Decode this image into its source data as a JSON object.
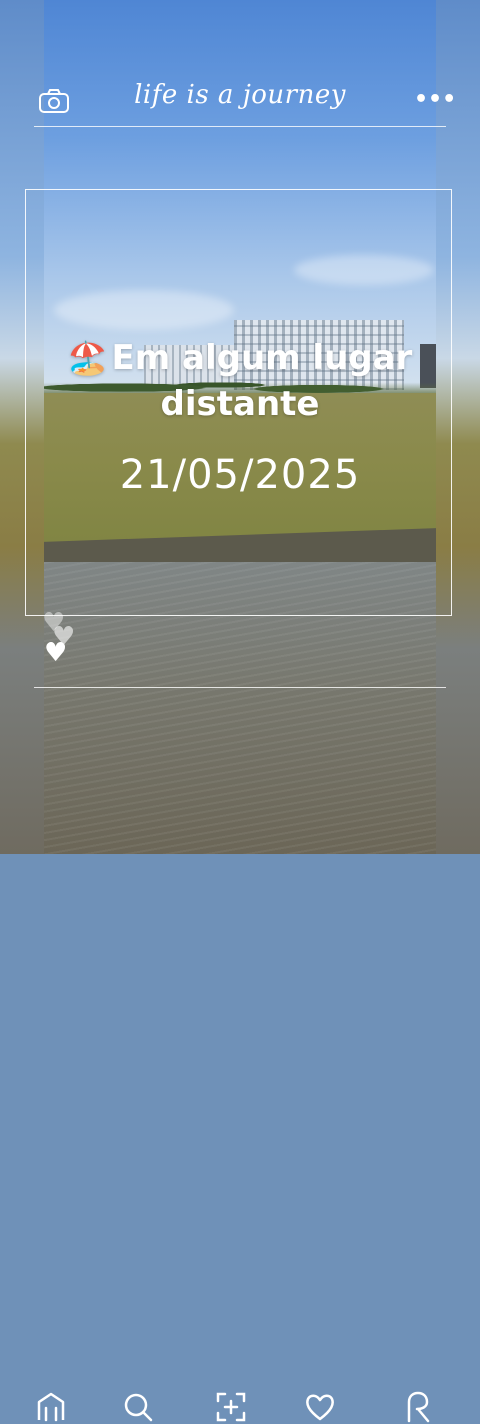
{
  "header": {
    "brand": "life is a journey",
    "camera_icon": "camera-icon",
    "more_icon": "more-dots-icon"
  },
  "overlay": {
    "emoji": "🏖️",
    "title": "Em algum lugar distante",
    "date": "21/05/2025"
  },
  "nav": {
    "items": [
      "home-icon",
      "search-icon",
      "add-photo-icon",
      "heart-icon",
      "profile-icon"
    ]
  },
  "colors": {
    "overlay_text": "#ffffff"
  }
}
